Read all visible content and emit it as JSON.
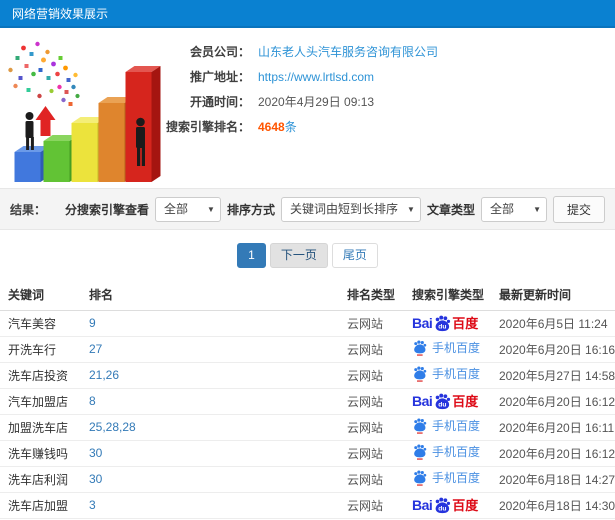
{
  "colors": {
    "topbar_blue": "#0a81d1",
    "link_blue": "#2e93d6",
    "count_orange": "#ff5500",
    "pagination_active": "#337ab7",
    "baidu_blue": "#2634dd",
    "baidu_red": "#dd0a16",
    "mobile_baidu_blue": "#4a90e2"
  },
  "header": {
    "title": "网络营销效果展示"
  },
  "info": {
    "fields": [
      {
        "label": "会员公司：",
        "value": "山东老人头汽车服务咨询有限公司"
      },
      {
        "label": "推广地址：",
        "value": "https://www.lrtlsd.com"
      },
      {
        "label": "开通时间：",
        "value": "2020年4月29日 09:13"
      },
      {
        "label": "搜索引擎排名：",
        "value": "4648",
        "suffix": "条"
      }
    ]
  },
  "filters": {
    "result_label": "结果：",
    "engine_filter_label": "分搜索引擎查看",
    "engine_filter_value": "全部",
    "sort_label": "排序方式",
    "sort_value": "关键词由短到长排序",
    "article_type_label": "文章类型",
    "article_type_value": "全部",
    "submit_label": "提交",
    "caret": "▼"
  },
  "pagination": {
    "current": "1",
    "next": "下一页",
    "last": "尾页"
  },
  "logos": {
    "baidu": {
      "bai": "Bai",
      "du": "du",
      "cn": "百度"
    },
    "mobile_baidu": {
      "label": "手机百度"
    }
  },
  "table": {
    "headers": [
      "关键词",
      "排名",
      "排名类型",
      "搜索引擎类型",
      "最新更新时间"
    ],
    "rows": [
      {
        "keyword": "汽车美容",
        "rank": "9",
        "rank_type": "云网站",
        "engine": "baidu",
        "time": "2020年6月5日 11:24"
      },
      {
        "keyword": "开洗车行",
        "rank": "27",
        "rank_type": "云网站",
        "engine": "mobile_baidu",
        "time": "2020年6月20日 16:16"
      },
      {
        "keyword": "洗车店投资",
        "rank": "21,26",
        "rank_type": "云网站",
        "engine": "mobile_baidu",
        "time": "2020年5月27日 14:58"
      },
      {
        "keyword": "汽车加盟店",
        "rank": "8",
        "rank_type": "云网站",
        "engine": "baidu",
        "time": "2020年6月20日 16:12"
      },
      {
        "keyword": "加盟洗车店",
        "rank": "25,28,28",
        "rank_type": "云网站",
        "engine": "mobile_baidu",
        "time": "2020年6月20日 16:11"
      },
      {
        "keyword": "洗车赚钱吗",
        "rank": "30",
        "rank_type": "云网站",
        "engine": "mobile_baidu",
        "time": "2020年6月20日 16:12"
      },
      {
        "keyword": "洗车店利润",
        "rank": "30",
        "rank_type": "云网站",
        "engine": "mobile_baidu",
        "time": "2020年6月18日 14:27"
      },
      {
        "keyword": "洗车店加盟",
        "rank": "3",
        "rank_type": "云网站",
        "engine": "baidu",
        "time": "2020年6月18日 14:30"
      }
    ]
  }
}
